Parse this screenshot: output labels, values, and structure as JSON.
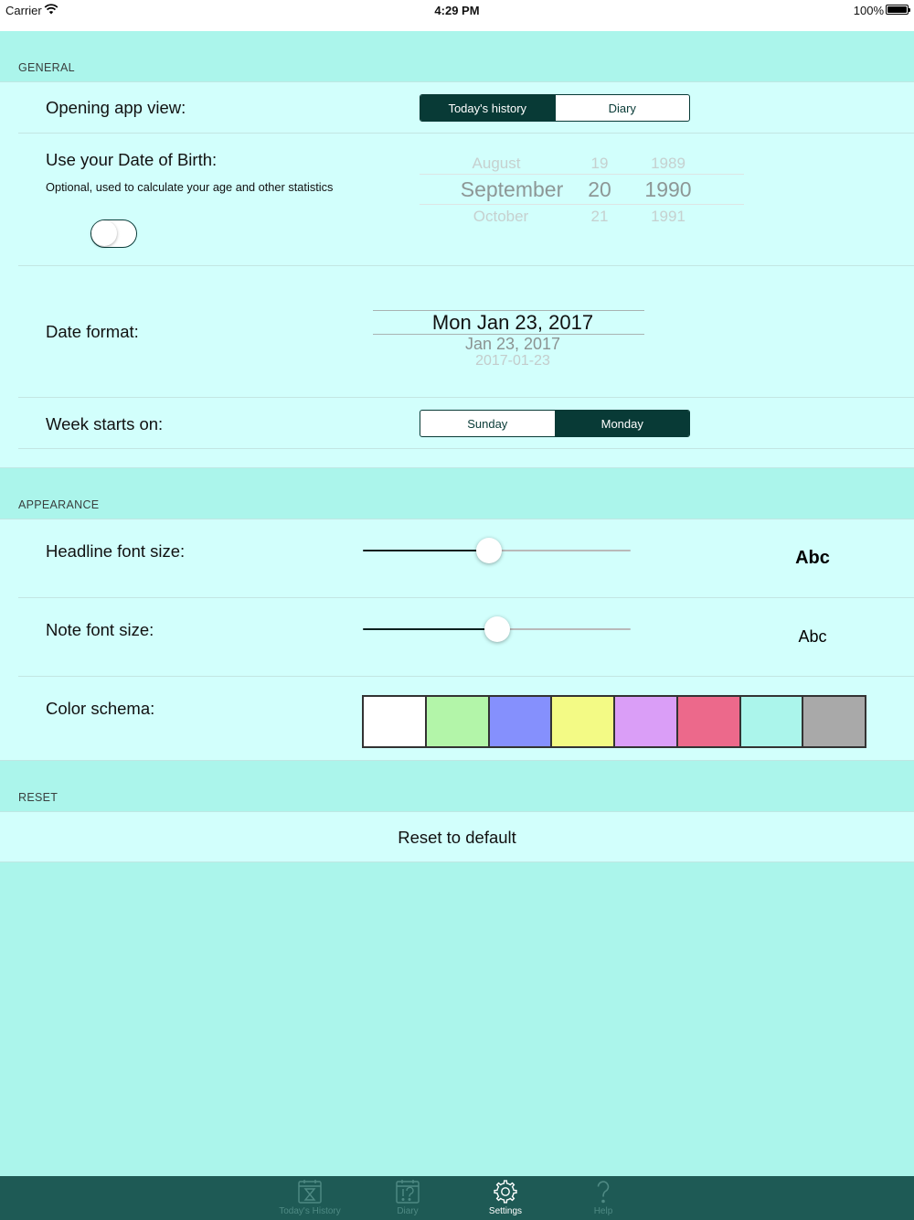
{
  "status_bar": {
    "carrier": "Carrier",
    "time": "4:29 PM",
    "battery": "100%"
  },
  "sections": {
    "general": "GENERAL",
    "appearance": "APPEARANCE",
    "reset": "RESET"
  },
  "general": {
    "opening_label": "Opening app view:",
    "opening_options": [
      "Today's history",
      "Diary"
    ],
    "opening_selected": "Today's history",
    "dob_label": "Use your Date of Birth:",
    "dob_subtitle": "Optional, used to calculate your age and other statistics",
    "dob_enabled": false,
    "dob_picker": {
      "months": [
        "August",
        "September",
        "October"
      ],
      "days": [
        "19",
        "20",
        "21"
      ],
      "years": [
        "1989",
        "1990",
        "1991"
      ]
    },
    "date_format_label": "Date format:",
    "date_format_options": [
      "Mon Jan 23, 2017",
      "Jan 23, 2017",
      "2017-01-23"
    ],
    "week_label": "Week starts on:",
    "week_options": [
      "Sunday",
      "Monday"
    ],
    "week_selected": "Monday"
  },
  "appearance": {
    "headline_label": "Headline font size:",
    "headline_value": 0.47,
    "headline_preview": "Abc",
    "note_label": "Note font size:",
    "note_value": 0.5,
    "note_preview": "Abc",
    "color_label": "Color schema:",
    "colors": [
      "#ffffff",
      "#b3f5a9",
      "#8590fd",
      "#f3fa85",
      "#da9ef7",
      "#ec698b",
      "#abf5eb",
      "#a9a9a9"
    ]
  },
  "reset": {
    "button": "Reset to default"
  },
  "tabs": [
    {
      "label": "Today's History",
      "icon": "hourglass-calendar-icon",
      "active": false
    },
    {
      "label": "Diary",
      "icon": "question-calendar-icon",
      "active": false
    },
    {
      "label": "Settings",
      "icon": "gear-icon",
      "active": true
    },
    {
      "label": "Help",
      "icon": "question-mark-icon",
      "active": false
    }
  ],
  "colors": {
    "accent": "#083a36",
    "background": "#abf5eb",
    "cell": "#d2fffc",
    "tabbar": "#1e5a55"
  }
}
